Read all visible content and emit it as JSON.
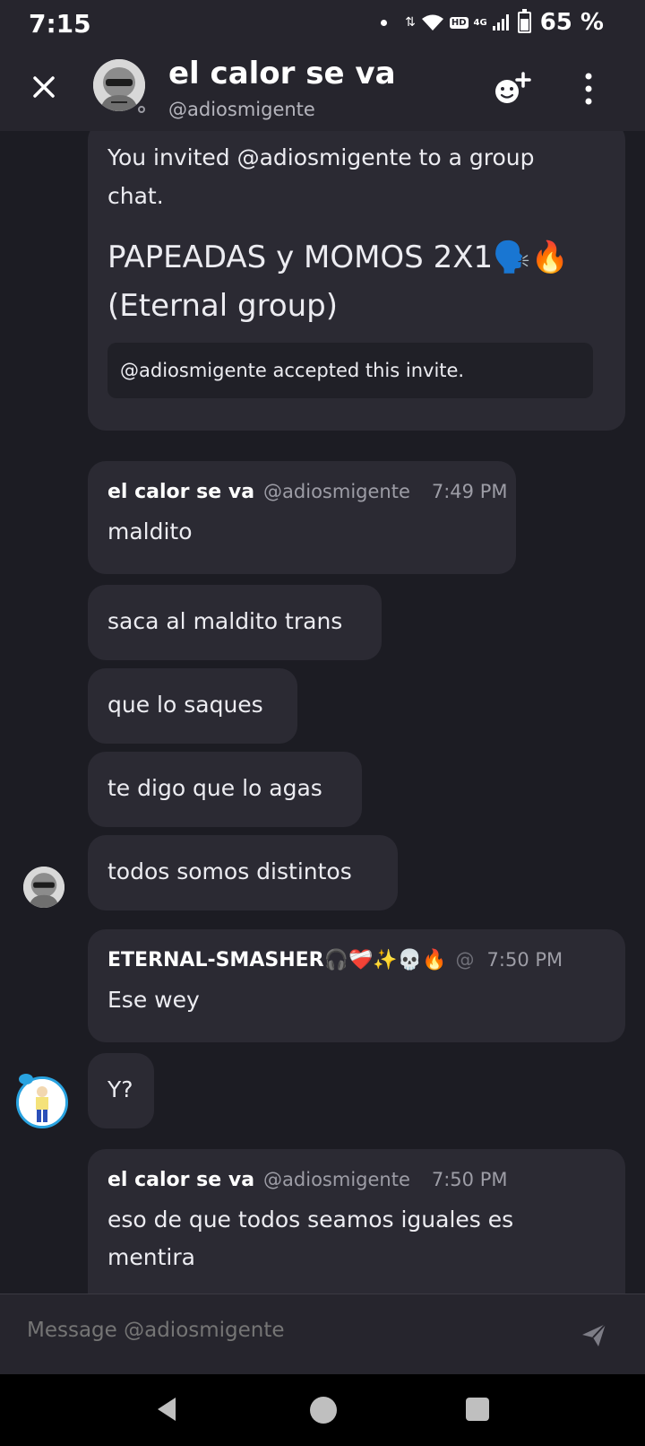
{
  "status_bar": {
    "time": "7:15",
    "hd": "HD",
    "network": "4G",
    "battery": "65 %",
    "battery_level": 0.65
  },
  "header": {
    "title": "el calor se va",
    "subtitle": "@adiosmigente",
    "icons": [
      "close-icon",
      "add-friend-icon",
      "more-vertical-icon"
    ]
  },
  "invite": {
    "text": "You invited @adiosmigente to a group chat.",
    "group_name": "PAPEADAS y MOMOS 2X1🗣️🔥(Eternal group)",
    "accepted": "@adiosmigente accepted this invite."
  },
  "messages": [
    {
      "author": "el calor se va",
      "handle": "@adiosmigente",
      "time": "7:49 PM",
      "text": "maldito"
    },
    {
      "text": "saca al maldito trans"
    },
    {
      "text": "que lo saques"
    },
    {
      "text": "te digo que lo agas"
    },
    {
      "text": "todos somos distintos"
    },
    {
      "author": "ETERNAL-SMASHER🎧❤️‍🩹✨💀🔥",
      "handle": "@",
      "time": "7:50 PM",
      "text": "Ese wey"
    },
    {
      "text": "Y?"
    },
    {
      "author": "el calor se va",
      "handle": "@adiosmigente",
      "time": "7:50 PM",
      "text": "eso de que todos seamos iguales es mentira"
    }
  ],
  "composer": {
    "placeholder": "Message @adiosmigente"
  },
  "nav": {
    "icons": [
      "back-icon",
      "home-icon",
      "recents-icon"
    ]
  },
  "colors": {
    "background": "#1c1c23",
    "bubble": "#2b2a33",
    "header": "#26252d",
    "avatar_ring": "#29a3e0"
  }
}
